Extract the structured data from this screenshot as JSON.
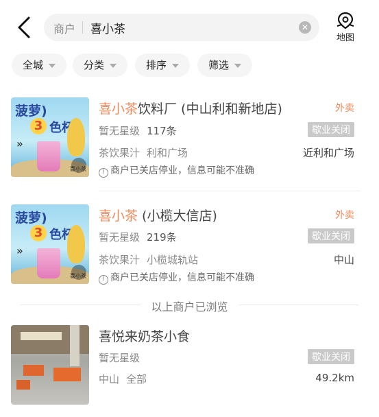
{
  "search": {
    "category": "商户",
    "query": "喜小茶",
    "clear_icon": "clear-icon",
    "back_icon": "back-chevron-icon",
    "map_icon": "map-pin-icon",
    "map_label": "地图"
  },
  "filters": [
    "全城",
    "分类",
    "排序",
    "筛选"
  ],
  "accent_color": "#f08a5d",
  "results": [
    {
      "title_highlight": "喜小茶",
      "title_rest": "饮料厂 (中山利和新地店)",
      "delivery": "外卖",
      "rating": "暂无星级",
      "reviews": "117条",
      "status": "歇业关闭",
      "category": "茶饮果汁",
      "area": "利和广场",
      "location": "近利和广场",
      "notice": "商户已关店停业，信息可能不准确",
      "thumb": {
        "title": "菠萝)",
        "three": "3",
        "cup": "色杯",
        "arrows": "»",
        "brand": "喜小茶"
      }
    },
    {
      "title_highlight": "喜小茶",
      "title_rest": " (小榄大信店)",
      "delivery": "外卖",
      "rating": "暂无星级",
      "reviews": "219条",
      "status": "歇业关闭",
      "category": "茶饮果汁",
      "area": "小榄城轨站",
      "location": "中山",
      "notice": "商户已关店停业，信息可能不准确",
      "thumb": {
        "title": "菠萝)",
        "three": "3",
        "cup": "色杯",
        "arrows": "»",
        "brand": "喜小茶"
      }
    }
  ],
  "browsed_text": "以上商户已浏览",
  "other": {
    "title": "喜悦来奶茶小食",
    "rating": "暂无星级",
    "status": "歇业关闭",
    "city": "中山",
    "area": "全部",
    "distance": "49.2km"
  }
}
